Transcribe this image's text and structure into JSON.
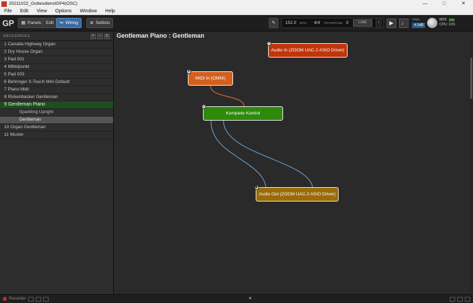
{
  "window": {
    "title": "20211022_GottesdienstGP4(OSC)",
    "controls": [
      "—",
      "□",
      "✕"
    ]
  },
  "menu": [
    "File",
    "Edit",
    "View",
    "Options",
    "Window",
    "Help"
  ],
  "toolbar": {
    "logo": "GP",
    "panels_label": "Panels",
    "edit_label": "Edit",
    "wiring_label": "Wiring",
    "setlists_label": "Setlists",
    "tempo": "152.0",
    "bpm_label": "BPM",
    "time_sig": "4/4",
    "transpose_label": "TRANSPOSE",
    "transpose_value": "0",
    "link_label": "LINK",
    "trim_label": "TRIM",
    "trim_value": "-4.5dB",
    "midi_label": "MIDI",
    "cpu_label": "CPU:",
    "cpu_value": "11%"
  },
  "sidebar": {
    "header": "RACKSPACES",
    "racks": [
      {
        "num": "1",
        "name": "Canada Highway Organ"
      },
      {
        "num": "2",
        "name": "Dry House Organ"
      },
      {
        "num": "3",
        "name": "Pad 001"
      },
      {
        "num": "4",
        "name": "Mittelpunkt"
      },
      {
        "num": "5",
        "name": "Pad 003"
      },
      {
        "num": "6",
        "name": "Behringer X-Touch Mini Default"
      },
      {
        "num": "7",
        "name": "Piano Midi"
      },
      {
        "num": "8",
        "name": "Rickenbacker Gentleman"
      },
      {
        "num": "9",
        "name": "Gentleman Piano"
      }
    ],
    "variations": [
      "Sparkling Upright",
      "Gentleman"
    ],
    "racks_after": [
      {
        "num": "10",
        "name": "Organ Gentleman"
      },
      {
        "num": "11",
        "name": "Muster"
      }
    ]
  },
  "canvas": {
    "title": "Gentleman Piano : Gentleman",
    "nodes": {
      "audio_in": "Audio In (ZOOM UAC-2 ASIO Driver)",
      "midi_in": "MIDI In (OMNI)",
      "plugin": "Komplete Kontrol",
      "audio_out": "Audio Out (ZOOM UAC-2 ASIO Driver)"
    }
  },
  "status": {
    "recorder_label": "Recorder"
  },
  "colors": {
    "audio_in": "#c0350a",
    "midi_in": "#d2601f",
    "plugin": "#2f8a0c",
    "audio_out": "#9a6b08",
    "midi_wire": "#d06a2e",
    "audio_wire": "#6a9bc7"
  },
  "icons": [
    "gp-logo-icon",
    "panels-icon",
    "wiring-icon",
    "setlists-icon",
    "wrench-icon",
    "play-icon",
    "metronome-icon",
    "knob-icon"
  ]
}
